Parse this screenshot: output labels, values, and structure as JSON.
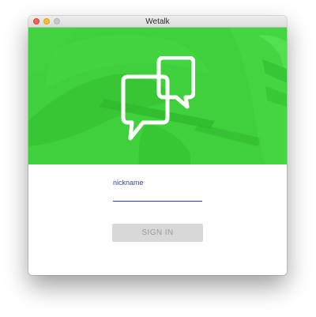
{
  "window": {
    "title": "Wetalk",
    "controls": [
      "close",
      "minimize",
      "zoom"
    ]
  },
  "hero": {
    "background_color": "#3ed13b",
    "icon": "chat-bubbles-icon"
  },
  "form": {
    "nickname_label": "nickname",
    "nickname_value": "",
    "signin_label": "SIGN IN"
  },
  "colors": {
    "accent": "#3448a3",
    "hero_green": "#3ed13b",
    "button_bg": "#d8d8d8",
    "button_text": "#9a9a9a"
  }
}
